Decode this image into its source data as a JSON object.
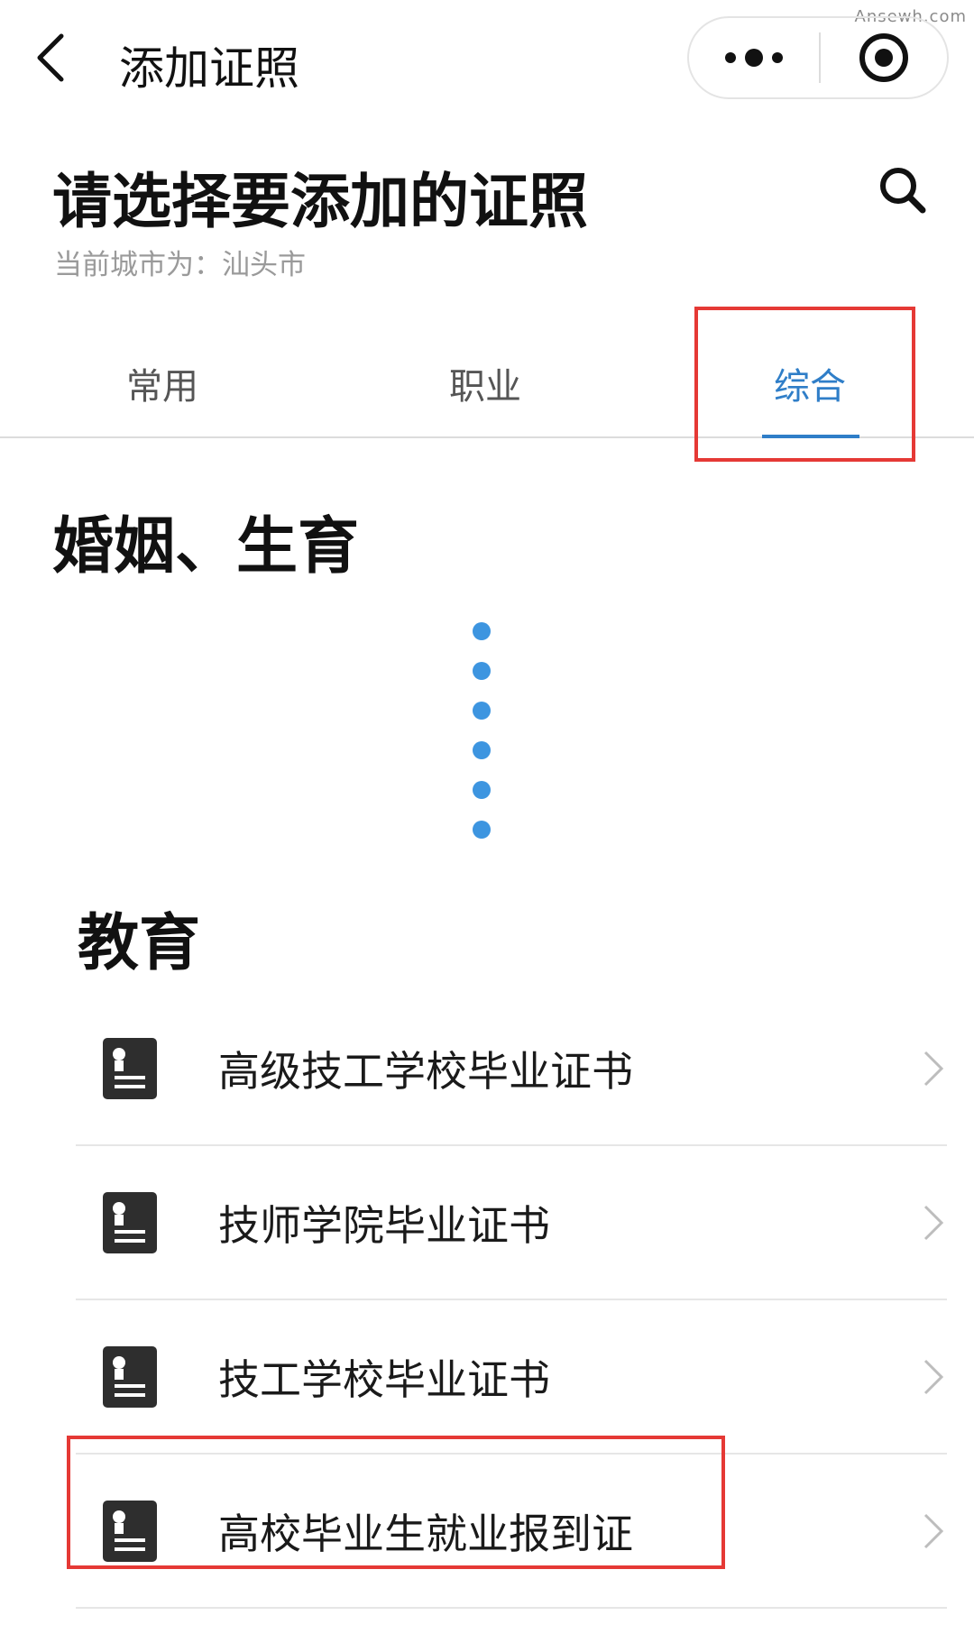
{
  "watermark": "Ansewh.com",
  "nav": {
    "title": "添加证照"
  },
  "header": {
    "title": "请选择要添加的证照",
    "city_line": "当前城市为：汕头市"
  },
  "tabs": [
    {
      "label": "常用"
    },
    {
      "label": "职业"
    },
    {
      "label": "综合",
      "active": true
    }
  ],
  "sections": [
    {
      "title": "婚姻、生育"
    },
    {
      "title": "教育",
      "items": [
        {
          "label": "高级技工学校毕业证书",
          "icon": "certificate-icon"
        },
        {
          "label": "技师学院毕业证书",
          "icon": "certificate-icon"
        },
        {
          "label": "技工学校毕业证书",
          "icon": "certificate-icon"
        },
        {
          "label": "高校毕业生就业报到证",
          "icon": "certificate-icon"
        }
      ]
    }
  ],
  "colors": {
    "accent": "#2f7ec8",
    "highlight": "#e53935",
    "dots": "#3d95e0"
  }
}
